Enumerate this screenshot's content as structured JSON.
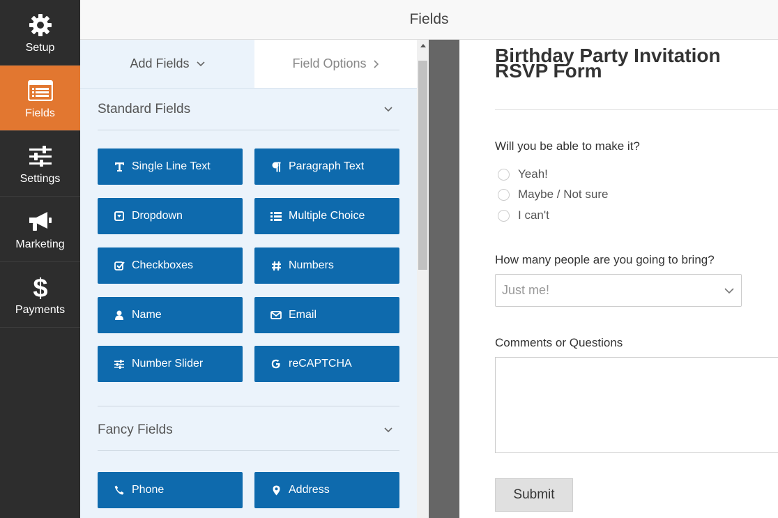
{
  "header": {
    "title": "Fields"
  },
  "nav": {
    "items": [
      {
        "label": "Setup",
        "icon": "gear-icon",
        "active": false
      },
      {
        "label": "Fields",
        "icon": "fields-list-icon",
        "active": true
      },
      {
        "label": "Settings",
        "icon": "sliders-icon",
        "active": false
      },
      {
        "label": "Marketing",
        "icon": "megaphone-icon",
        "active": false
      },
      {
        "label": "Payments",
        "icon": "dollar-icon",
        "active": false
      }
    ]
  },
  "panel": {
    "tabs": [
      {
        "label": "Add Fields",
        "icon": "chevron-down-icon"
      },
      {
        "label": "Field Options",
        "icon": "chevron-right-icon"
      }
    ],
    "standard": {
      "title": "Standard Fields",
      "fields": [
        {
          "label": "Single Line Text",
          "icon": "text-icon"
        },
        {
          "label": "Paragraph Text",
          "icon": "paragraph-icon"
        },
        {
          "label": "Dropdown",
          "icon": "dropdown-icon"
        },
        {
          "label": "Multiple Choice",
          "icon": "list-icon"
        },
        {
          "label": "Checkboxes",
          "icon": "checkbox-icon"
        },
        {
          "label": "Numbers",
          "icon": "hash-icon"
        },
        {
          "label": "Name",
          "icon": "user-icon"
        },
        {
          "label": "Email",
          "icon": "envelope-icon"
        },
        {
          "label": "Number Slider",
          "icon": "slider-icon"
        },
        {
          "label": "reCAPTCHA",
          "icon": "google-icon"
        }
      ]
    },
    "fancy": {
      "title": "Fancy Fields",
      "fields": [
        {
          "label": "Phone",
          "icon": "phone-icon"
        },
        {
          "label": "Address",
          "icon": "map-marker-icon"
        }
      ]
    }
  },
  "form": {
    "title": "Birthday Party Invitation RSVP Form",
    "q1": {
      "label": "Will you be able to make it?",
      "options": [
        "Yeah!",
        "Maybe / Not sure",
        "I can't"
      ]
    },
    "q2": {
      "label": "How many people are you going to bring?",
      "selected": "Just me!"
    },
    "q3": {
      "label": "Comments or Questions"
    },
    "submit": "Submit"
  },
  "colors": {
    "nav_bg": "#2d2d2d",
    "nav_active": "#e27730",
    "field_button": "#0e6aad",
    "panel_bg": "#ebf3fb"
  }
}
